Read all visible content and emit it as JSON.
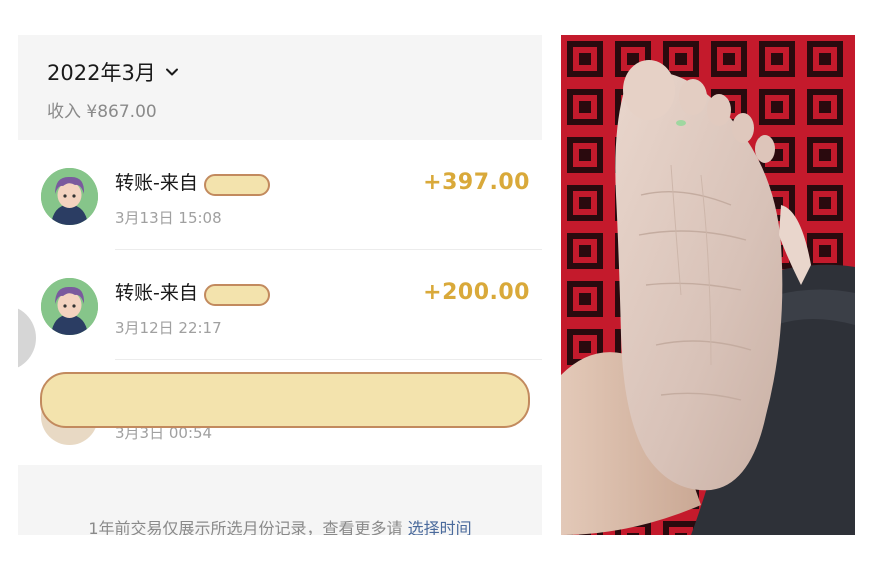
{
  "header": {
    "month": "2022年3月",
    "income": "收入 ¥867.00"
  },
  "transactions": [
    {
      "title": "转账-来自",
      "time": "3月13日 15:08",
      "amount": "+397.00"
    },
    {
      "title": "转账-来自",
      "time": "3月12日 22:17",
      "amount": "+200.00"
    },
    {
      "title": "",
      "time": "3月3日 00:54",
      "amount": ""
    }
  ],
  "footer": {
    "note": "1年前交易仅展示所选月份记录，查看更多请",
    "link": "选择时间"
  },
  "colors": {
    "amount": "#d9a93a",
    "link": "#4a6a9c",
    "redaction_fill": "#f3e3ad",
    "redaction_border": "#c28a5e"
  },
  "icons": {
    "month_dropdown": "chevron-down-icon",
    "avatar": "anime-avatar"
  },
  "photo": {
    "subject": "bare foot sole on a red and black patterned carpet"
  }
}
